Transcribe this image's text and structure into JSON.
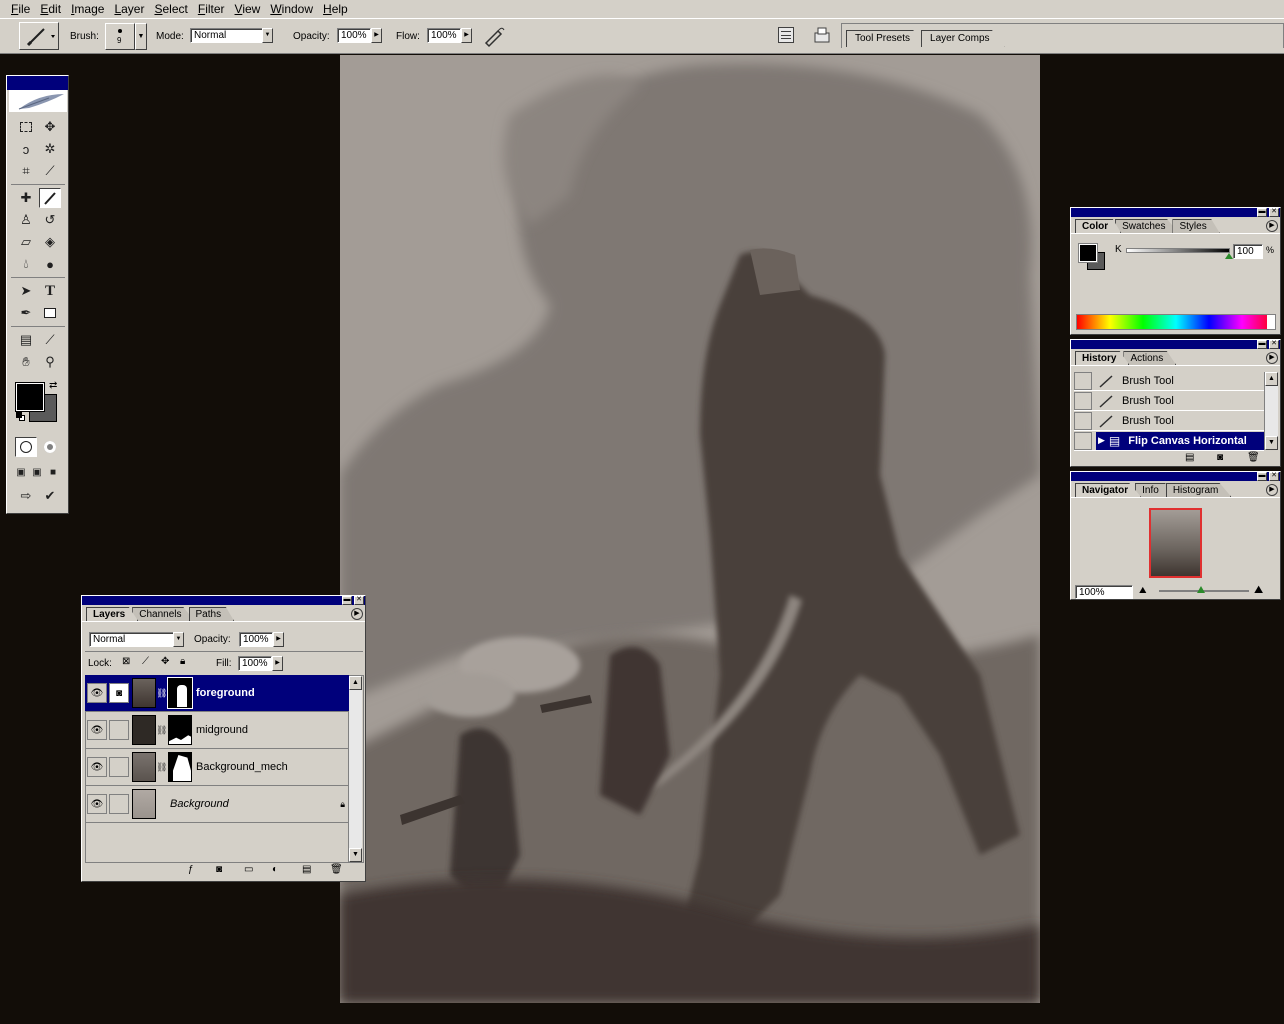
{
  "menubar": {
    "items": [
      "File",
      "Edit",
      "Image",
      "Layer",
      "Select",
      "Filter",
      "View",
      "Window",
      "Help"
    ]
  },
  "options": {
    "brush_label": "Brush:",
    "brush_size": "9",
    "mode_label": "Mode:",
    "mode_value": "Normal",
    "opacity_label": "Opacity:",
    "opacity_value": "100%",
    "flow_label": "Flow:",
    "flow_value": "100%",
    "dock_tabs": [
      "Tool Presets",
      "Layer Comps"
    ]
  },
  "color_panel": {
    "tabs": [
      "Color",
      "Swatches",
      "Styles"
    ],
    "channel_label": "K",
    "channel_value": "100",
    "unit": "%",
    "slider_fraction": 1.0
  },
  "history_panel": {
    "tabs": [
      "History",
      "Actions"
    ],
    "items": [
      "Brush Tool",
      "Brush Tool",
      "Brush Tool",
      "Flip Canvas Horizontal"
    ],
    "selected_index": 3
  },
  "navigator_panel": {
    "tabs": [
      "Navigator",
      "Info",
      "Histogram"
    ],
    "zoom": "100%"
  },
  "layers_panel": {
    "tabs": [
      "Layers",
      "Channels",
      "Paths"
    ],
    "blend_mode": "Normal",
    "opacity_label": "Opacity:",
    "opacity_value": "100%",
    "lock_label": "Lock:",
    "fill_label": "Fill:",
    "fill_value": "100%",
    "layers": [
      {
        "name": "foreground",
        "selected": true
      },
      {
        "name": "midground",
        "selected": false
      },
      {
        "name": "Background_mech",
        "selected": false
      },
      {
        "name": "Background",
        "selected": false,
        "locked": true
      }
    ]
  },
  "colors": {
    "title_bar": "#00007b",
    "chrome": "#d4d0c8",
    "foreground_color": "#000000",
    "background_color": "#5a5a5a"
  }
}
